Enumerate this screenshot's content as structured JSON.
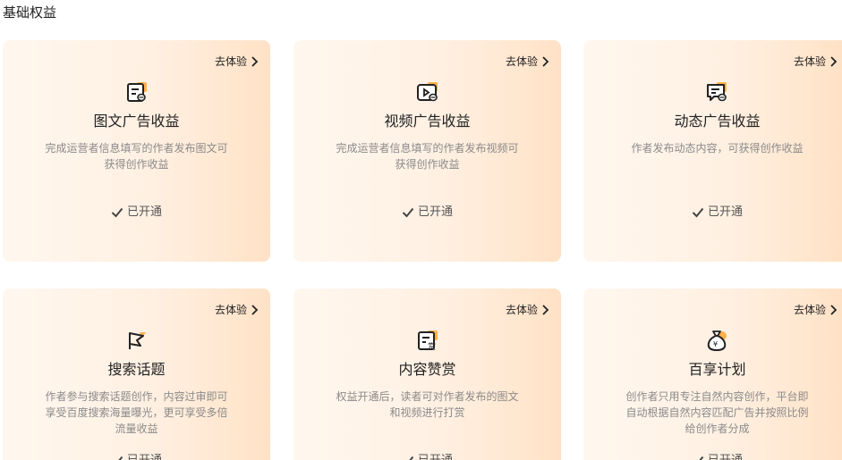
{
  "section": {
    "title": "基础权益"
  },
  "colors": {
    "accent": "#ff9e2c",
    "icon": "#222222"
  },
  "cards": [
    {
      "title": "图文广告收益",
      "link": "去体验",
      "desc": [
        "完成运营者信息填写的作者发布图文可",
        "获得创作收益"
      ],
      "status": "已开通",
      "icon": "article-coin-icon"
    },
    {
      "title": "视频广告收益",
      "link": "去体验",
      "desc": [
        "完成运营者信息填写的作者发布视频可",
        "获得创作收益"
      ],
      "status": "已开通",
      "icon": "video-coin-icon"
    },
    {
      "title": "动态广告收益",
      "link": "去体验",
      "desc": [
        "作者发布动态内容，可获得创作收益"
      ],
      "status": "已开通",
      "icon": "message-coin-icon"
    },
    {
      "title": "搜索话题",
      "link": "去体验",
      "desc": [
        "作者参与搜索话题创作，内容过审即可",
        "享受百度搜索海量曝光，更可享受多倍",
        "流量收益"
      ],
      "status": "已开通",
      "icon": "flag-icon"
    },
    {
      "title": "内容赞赏",
      "link": "去体验",
      "desc": [
        "权益开通后，读者可对作者发布的图文",
        "和视频进行打赏"
      ],
      "status": "已开通",
      "icon": "reward-icon"
    },
    {
      "title": "百享计划",
      "link": "去体验",
      "desc": [
        "创作者只用专注自然内容创作，平台即",
        "自动根据自然内容匹配广告并按照比例",
        "给创作者分成"
      ],
      "status": "已开通",
      "icon": "money-bag-icon"
    }
  ]
}
